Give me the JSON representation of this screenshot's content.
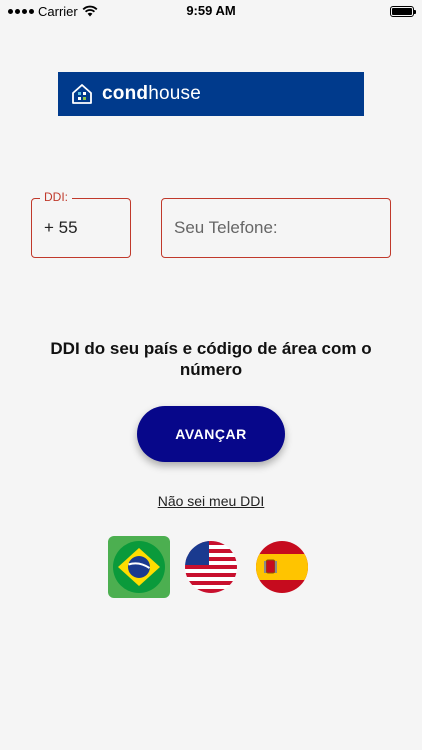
{
  "status_bar": {
    "carrier": "Carrier",
    "time": "9:59 AM"
  },
  "logo": {
    "bold": "cond",
    "light": "house",
    "color": "#003a8c"
  },
  "ddi": {
    "legend": "DDI:",
    "value": "+ 55"
  },
  "phone": {
    "placeholder": "Seu Telefone:"
  },
  "instruction": "DDI do seu país e código de área com o número",
  "advance_button": {
    "label": "AVANÇAR",
    "color": "#07078a"
  },
  "help_link": "Não sei meu DDI",
  "flags": [
    {
      "country": "Brasil",
      "icon": "brazil-flag-icon",
      "selected": true
    },
    {
      "country": "Estados Unidos",
      "icon": "usa-flag-icon",
      "selected": false
    },
    {
      "country": "Espanha",
      "icon": "spain-flag-icon",
      "selected": false
    }
  ],
  "colors": {
    "field_border": "#c0392b",
    "selected_flag_bg": "#4caf50"
  }
}
